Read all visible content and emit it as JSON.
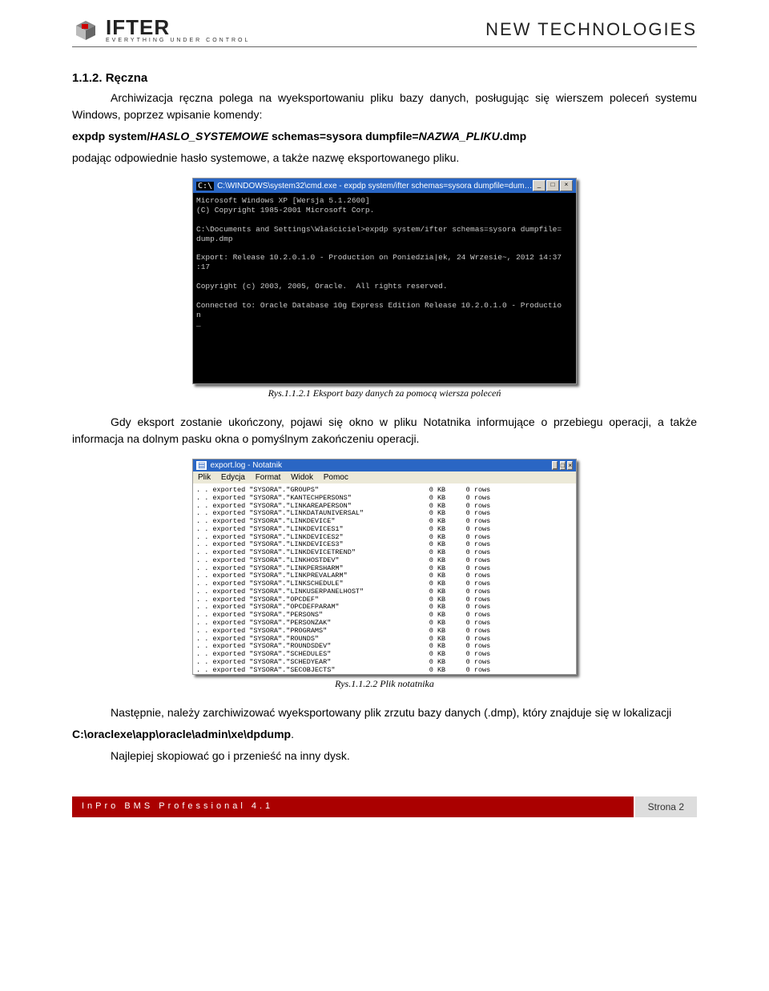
{
  "header": {
    "logo_main": "IFTER",
    "logo_tag": "EVERYTHING UNDER CONTROL",
    "right": "NEW TECHNOLOGIES"
  },
  "section": {
    "number_title": "1.1.2. Ręczna",
    "para1": "Archiwizacja ręczna polega na wyeksportowaniu pliku bazy danych, posługując się wierszem poleceń systemu Windows, poprzez wpisanie komendy:",
    "cmd_prefix": "expdp system/",
    "cmd_italic1": "HASLO_SYSTEMOWE",
    "cmd_mid": " schemas=sysora dumpfile=",
    "cmd_italic2": "NAZWA_PLIKU",
    "cmd_suffix": ".dmp",
    "para2": "podając odpowiednie hasło systemowe, a także nazwę eksportowanego pliku."
  },
  "cmdwin": {
    "title_icon": "C:\\",
    "title": "C:\\WINDOWS\\system32\\cmd.exe - expdp system/ifter schemas=sysora dumpfile=dump.dmp",
    "min": "_",
    "max": "□",
    "close": "×",
    "body": "Microsoft Windows XP [Wersja 5.1.2600]\n(C) Copyright 1985-2001 Microsoft Corp.\n\nC:\\Documents and Settings\\Właściciel>expdp system/ifter schemas=sysora dumpfile=\ndump.dmp\n\nExport: Release 10.2.0.1.0 - Production on Poniedzia|ek, 24 Wrzesie~, 2012 14:37\n:17\n\nCopyright (c) 2003, 2005, Oracle.  All rights reserved.\n\nConnected to: Oracle Database 10g Express Edition Release 10.2.0.1.0 - Productio\nn\n_"
  },
  "fig1": "Rys.1.1.2.1 Eksport bazy danych za pomocą wiersza poleceń",
  "mid": {
    "para": "Gdy eksport zostanie ukończony, pojawi się okno w pliku Notatnika informujące o przebiegu operacji, a także informacja na dolnym pasku okna o pomyślnym zakończeniu operacji."
  },
  "notepad": {
    "title": "export.log - Notatnik",
    "menu": {
      "m1": "Plik",
      "m2": "Edycja",
      "m3": "Format",
      "m4": "Widok",
      "m5": "Pomoc"
    },
    "body": ". . exported \"SYSORA\".\"GROUPS\"                           0 KB     0 rows\n. . exported \"SYSORA\".\"KANTECHPERSONS\"                   0 KB     0 rows\n. . exported \"SYSORA\".\"LINKAREAPERSON\"                   0 KB     0 rows\n. . exported \"SYSORA\".\"LINKDATAUNIVERSAL\"                0 KB     0 rows\n. . exported \"SYSORA\".\"LINKDEVICE\"                       0 KB     0 rows\n. . exported \"SYSORA\".\"LINKDEVICES1\"                     0 KB     0 rows\n. . exported \"SYSORA\".\"LINKDEVICES2\"                     0 KB     0 rows\n. . exported \"SYSORA\".\"LINKDEVICES3\"                     0 KB     0 rows\n. . exported \"SYSORA\".\"LINKDEVICETREND\"                  0 KB     0 rows\n. . exported \"SYSORA\".\"LINKHOSTDEV\"                      0 KB     0 rows\n. . exported \"SYSORA\".\"LINKPERSHARM\"                     0 KB     0 rows\n. . exported \"SYSORA\".\"LINKPREVALARM\"                    0 KB     0 rows\n. . exported \"SYSORA\".\"LINKSCHEDULE\"                     0 KB     0 rows\n. . exported \"SYSORA\".\"LINKUSERPANELHOST\"                0 KB     0 rows\n. . exported \"SYSORA\".\"OPCDEF\"                           0 KB     0 rows\n. . exported \"SYSORA\".\"OPCDEFPARAM\"                      0 KB     0 rows\n. . exported \"SYSORA\".\"PERSONS\"                          0 KB     0 rows\n. . exported \"SYSORA\".\"PERSONZAK\"                        0 KB     0 rows\n. . exported \"SYSORA\".\"PROGRAMS\"                         0 KB     0 rows\n. . exported \"SYSORA\".\"ROUNDS\"                           0 KB     0 rows\n. . exported \"SYSORA\".\"ROUNDSDEV\"                        0 KB     0 rows\n. . exported \"SYSORA\".\"SCHEDULES\"                        0 KB     0 rows\n. . exported \"SYSORA\".\"SCHEDYEAR\"                        0 KB     0 rows\n. . exported \"SYSORA\".\"SECOBJECTS\"                       0 KB     0 rows\n. . exported \"SYSORA\".\"TASKS\"                            0 KB     0 rows\n. . exported \"SYSORA\".\"THRESHOLD\"                        0 KB     0 rows\n. . exported \"SYSORA\".\"THRESHOLDPROPS\"                   0 KB     0 rows\n. . exported \"SYSORA\".\"TRENDLOG\"                         0 KB     0 rows\n. . exported \"SYSORA\".\"TRENDS\"                           0 KB     0 rows\n. . exported \"SYSORA\".\"VIEWLOG\"                          0 KB     0 rows\nMaster table \"SYSTEM\".\"SYS_EXPORT_SCHEMA_01\" successfully loaded/unloaded\n******************************************************************************\nDump file set for SYSTEM.SYS_EXPORT_SCHEMA_01 is:\n  C:\\ORACLEXE\\APP\\ORACLE\\ADMIN\\XE\\DPDUMP\\SYSORA_20120924.DMP\nJob \"SYSTEM\".\"SYS_EXPORT_SCHEMA_01\" successfully completed at 12:34:44"
  },
  "fig2": "Rys.1.1.2.2 Plik notatnika",
  "tail": {
    "p1": "Następnie, należy zarchiwizować wyeksportowany plik zrzutu bazy danych (.dmp), który znajduje się w lokalizacji",
    "path": "C:\\oraclexe\\app\\oracle\\admin\\xe\\dpdump",
    "p2_suffix": ".",
    "p3": "Najlepiej skopiować go i przenieść na inny dysk."
  },
  "footer": {
    "left": "InPro BMS Professional 4.1",
    "right": "Strona 2"
  }
}
